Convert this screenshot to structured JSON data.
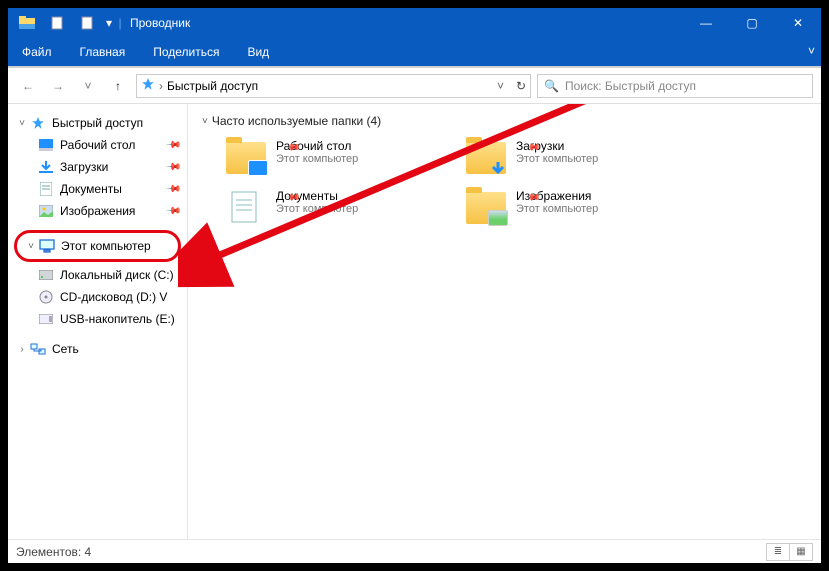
{
  "titlebar": {
    "title": "Проводник"
  },
  "window_controls": {
    "min": "—",
    "max": "▢",
    "close": "✕"
  },
  "ribbon": {
    "file": "Файл",
    "tabs": [
      "Главная",
      "Поделиться",
      "Вид"
    ]
  },
  "nav": {
    "back": "←",
    "forward": "→",
    "recent": "˅",
    "up": "↑"
  },
  "address": {
    "crumb_sep": "›",
    "location": "Быстрый доступ",
    "dropdown_glyph": "˅",
    "refresh_glyph": "↻"
  },
  "search": {
    "icon": "🔍",
    "placeholder": "Поиск: Быстрый доступ"
  },
  "sidebar": {
    "quick_access": {
      "chevron": "˅",
      "label": "Быстрый доступ"
    },
    "quick_items": [
      {
        "label": "Рабочий стол",
        "icon": "desktop"
      },
      {
        "label": "Загрузки",
        "icon": "downloads"
      },
      {
        "label": "Документы",
        "icon": "documents"
      },
      {
        "label": "Изображения",
        "icon": "pictures"
      }
    ],
    "this_pc": {
      "chevron": "˅",
      "label": "Этот компьютер"
    },
    "pc_items": [
      {
        "label": "Локальный диск (C:)"
      },
      {
        "label": "CD-дисковод (D:) V"
      },
      {
        "label": "USB-накопитель (E:)"
      }
    ],
    "network": {
      "chevron": "›",
      "label": "Сеть"
    }
  },
  "content": {
    "section_chevron": "˅",
    "section_title": "Часто используемые папки (4)",
    "folders": [
      {
        "name": "Рабочий стол",
        "sub": "Этот компьютер",
        "overlay": "desktop"
      },
      {
        "name": "Загрузки",
        "sub": "Этот компьютер",
        "overlay": "downloads"
      },
      {
        "name": "Документы",
        "sub": "Этот компьютер",
        "overlay": "documents"
      },
      {
        "name": "Изображения",
        "sub": "Этот компьютер",
        "overlay": "pictures"
      }
    ]
  },
  "statusbar": {
    "text": "Элементов: 4"
  }
}
